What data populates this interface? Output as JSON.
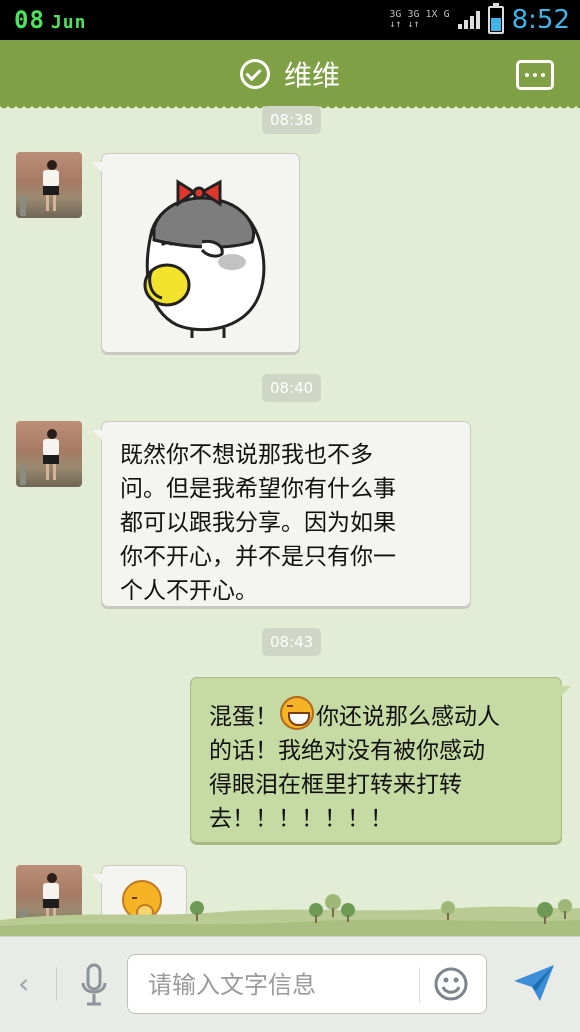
{
  "status_bar": {
    "day": "08",
    "month": "Jun",
    "network": [
      "3G",
      "3G 1X",
      "G"
    ],
    "time": "8:52",
    "battery_level": 0.55
  },
  "header": {
    "title": "维维",
    "verified_icon": "check-circle-icon",
    "more_icon": "more-dots-icon"
  },
  "chat": {
    "timestamps": [
      "08:38",
      "08:40",
      "08:43"
    ],
    "messages": [
      {
        "from": "them",
        "type": "sticker",
        "sticker": "white-chick-with-red-bow-sticker"
      },
      {
        "from": "them",
        "type": "text",
        "lines": [
          "既然你不想说那我也不多",
          "问。但是我希望你有什么事",
          "都可以跟我分享。因为如果",
          "你不开心，并不是只有你一",
          "个人不开心。"
        ]
      },
      {
        "from": "me",
        "type": "text",
        "line1_before": "混蛋！",
        "line1_after": "你还说那么感动人",
        "lines": [
          "的话！我绝对没有被你感动",
          "得眼泪在框里打转来打转",
          "去！！！！！！！"
        ],
        "emoji": "grinning-face-icon"
      },
      {
        "from": "them",
        "type": "emoji",
        "emoji": "blushing-face-icon"
      }
    ]
  },
  "input_bar": {
    "placeholder": "请输入文字信息",
    "value": ""
  },
  "colors": {
    "header": "#7fa044",
    "background": "#e3edd5",
    "outgoing_bubble": "#c6dba3",
    "incoming_bubble": "#f4f4f1",
    "time_accent": "#3fb4e8"
  }
}
